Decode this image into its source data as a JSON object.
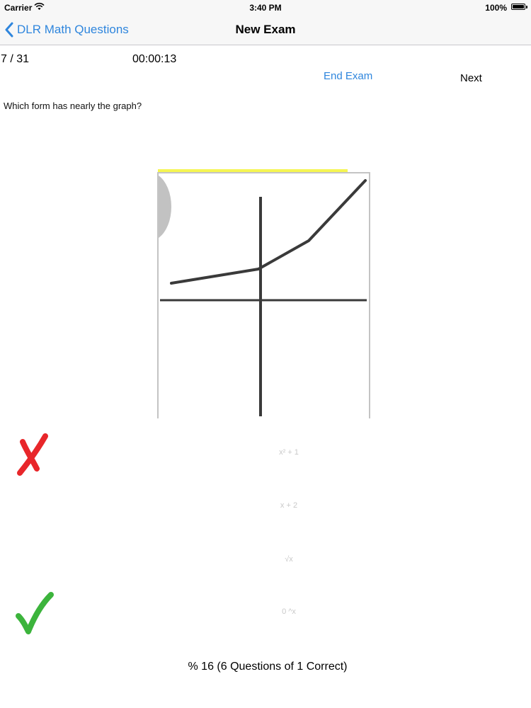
{
  "status_bar": {
    "carrier": "Carrier",
    "time": "3:40 PM",
    "battery": "100%",
    "wifi_icon": "wifi-icon",
    "battery_icon": "battery-icon"
  },
  "nav": {
    "back_label": "DLR Math Questions",
    "title": "New Exam",
    "back_icon": "chevron-left-icon"
  },
  "exam": {
    "progress": "7 / 31",
    "timer": "00:00:13",
    "end_exam_label": "End Exam",
    "next_label": "Next"
  },
  "question": {
    "text": "Which form has nearly the graph?",
    "graph_image": "graph-image"
  },
  "answers": [
    {
      "label": "x² + 1",
      "mark": "x-mark-icon"
    },
    {
      "label": "x + 2",
      "mark": ""
    },
    {
      "label": "√x",
      "mark": ""
    },
    {
      "label": "0 ^x",
      "mark": "check-mark-icon"
    }
  ],
  "score": {
    "summary": "% 16 (6 Questions of 1 Correct)"
  },
  "colors": {
    "accent": "#2f86dd",
    "wrong": "#e8262a",
    "correct": "#3cb43c",
    "highlight": "#f5f552"
  }
}
